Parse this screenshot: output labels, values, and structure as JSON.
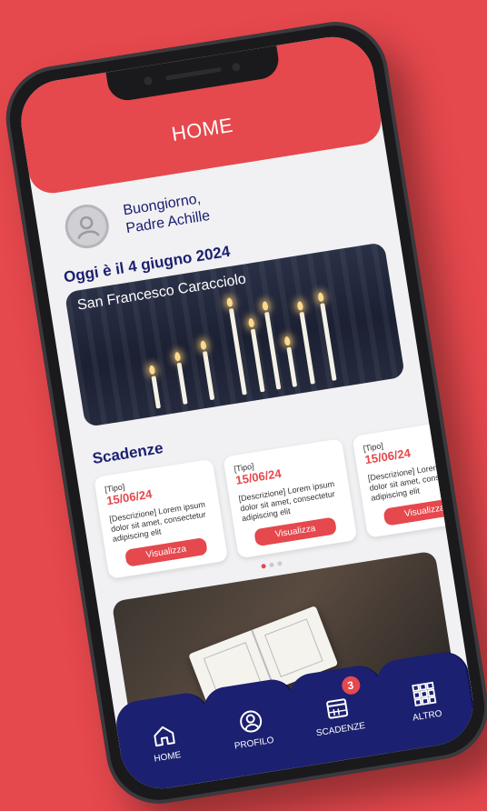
{
  "header": {
    "title": "HOME"
  },
  "greeting": {
    "line1": "Buongiorno,",
    "line2": "Padre Achille"
  },
  "date_title": "Oggi è il 4 giugno 2024",
  "hero": {
    "saint": "San Francesco Caracciolo"
  },
  "deadlines": {
    "title": "Scadenze",
    "cards": [
      {
        "type": "[Tipo]",
        "date": "15/06/24",
        "description": "[Descrizione] Lorem ipsum dolor sit amet, consectetur adipiscing elit",
        "button": "Visualizza"
      },
      {
        "type": "[Tipo]",
        "date": "15/06/24",
        "description": "[Descrizione] Lorem ipsum dolor sit amet, consectetur adipiscing elit",
        "button": "Visualizza"
      },
      {
        "type": "[Tipo]",
        "date": "15/06/24",
        "description": "[Descrizione] Lorem ipsum dolor sit amet, consectetur adipiscing elit",
        "button": "Visualizza"
      }
    ]
  },
  "tabs": [
    {
      "label": "HOME",
      "icon": "home-icon"
    },
    {
      "label": "PROFILO",
      "icon": "user-icon"
    },
    {
      "label": "SCADENZE",
      "icon": "calendar-icon",
      "badge": "3"
    },
    {
      "label": "ALTRO",
      "icon": "grid-icon"
    }
  ],
  "colors": {
    "accent": "#e5484d",
    "primary": "#1c2070",
    "background": "#f1f1f3"
  }
}
